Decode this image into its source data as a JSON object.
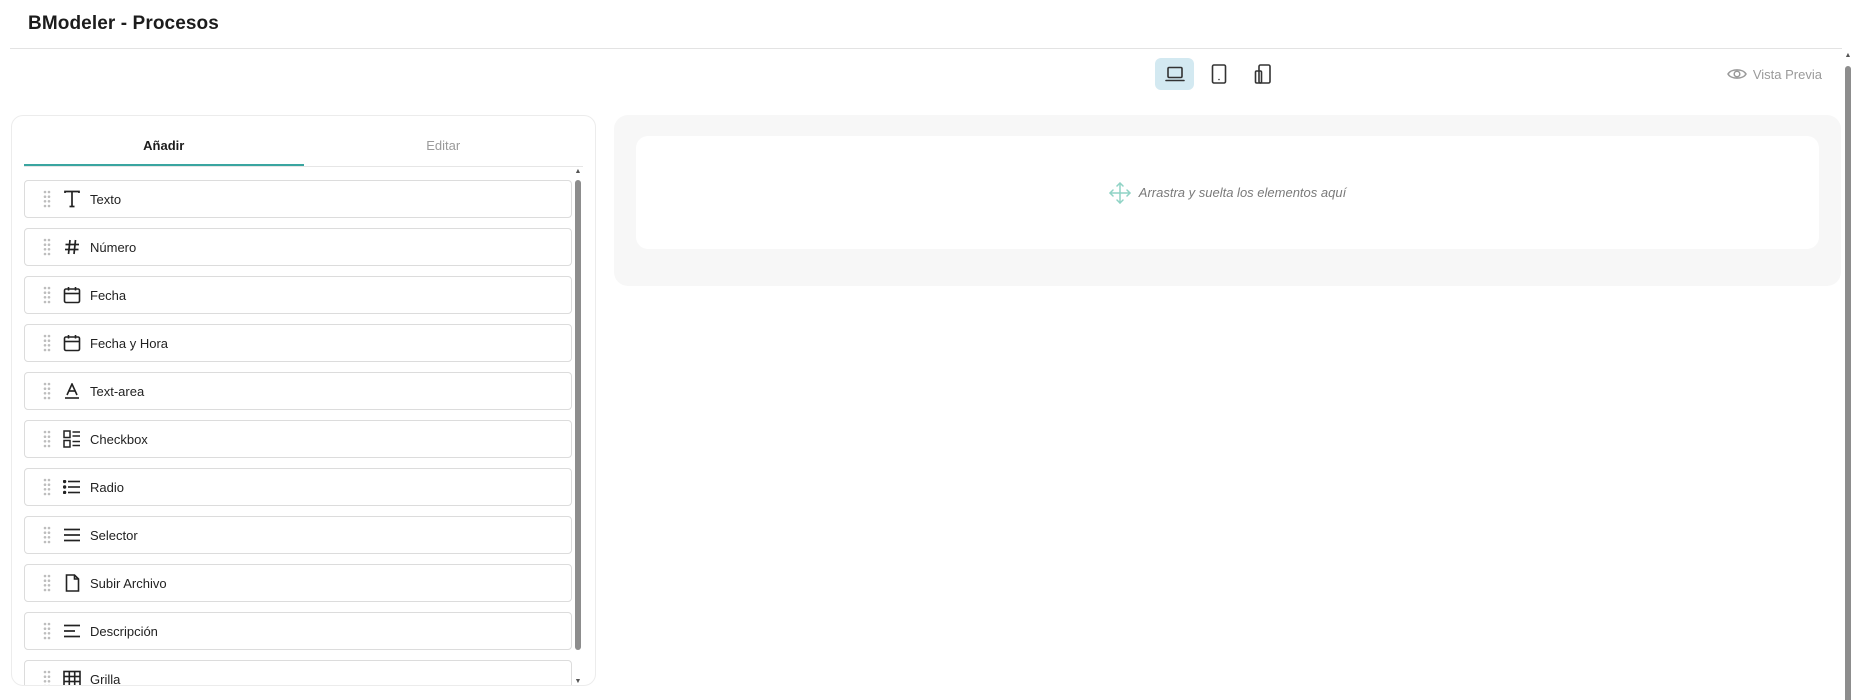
{
  "header": {
    "title": "BModeler - Procesos"
  },
  "devices": [
    {
      "name": "laptop-icon",
      "active": true
    },
    {
      "name": "tablet-icon",
      "active": false
    },
    {
      "name": "mobile-icon",
      "active": false
    }
  ],
  "preview": {
    "label": "Vista Previa",
    "icon": "eye-icon"
  },
  "tabs": [
    {
      "label": "Añadir",
      "active": true
    },
    {
      "label": "Editar",
      "active": false
    }
  ],
  "items": [
    {
      "label": "Texto",
      "icon": "text-icon"
    },
    {
      "label": "Número",
      "icon": "hash-icon"
    },
    {
      "label": "Fecha",
      "icon": "calendar-icon"
    },
    {
      "label": "Fecha y Hora",
      "icon": "calendar-icon"
    },
    {
      "label": "Text-area",
      "icon": "text-area-icon"
    },
    {
      "label": "Checkbox",
      "icon": "checklist-icon"
    },
    {
      "label": "Radio",
      "icon": "list-icon"
    },
    {
      "label": "Selector",
      "icon": "menu-icon"
    },
    {
      "label": "Subir Archivo",
      "icon": "file-icon"
    },
    {
      "label": "Descripción",
      "icon": "align-left-icon"
    },
    {
      "label": "Grilla",
      "icon": "grid-icon"
    }
  ],
  "canvas": {
    "drop_text": "Arrastra y suelta los elementos aquí",
    "icon": "move-icon"
  },
  "colors": {
    "accent": "#3aa5a0",
    "active_device_bg": "#d3e9f1",
    "canvas_bg": "#f7f7f7",
    "move_icon": "#8fd3c5"
  }
}
